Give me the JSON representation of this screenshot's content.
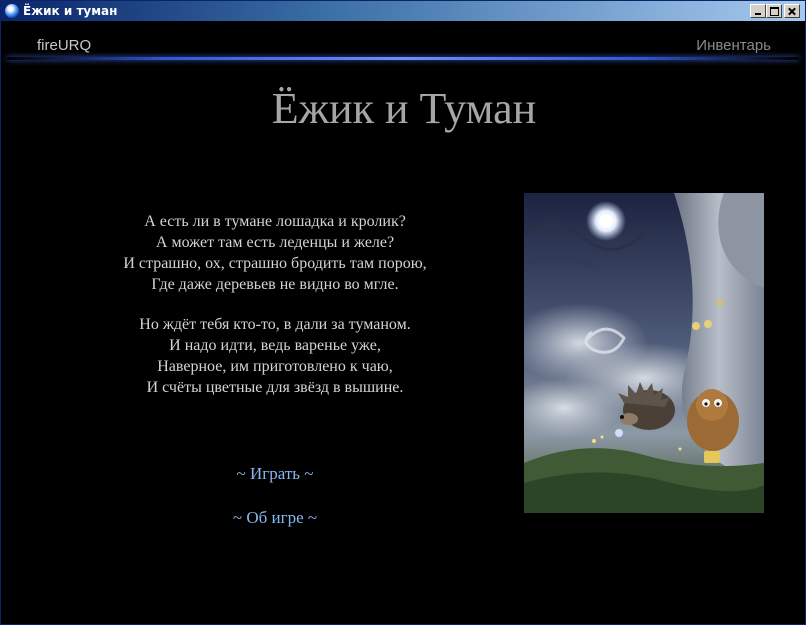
{
  "window": {
    "title": "Ёжик и туман"
  },
  "header": {
    "brand": "fireURQ",
    "inventory_label": "Инвентарь"
  },
  "game": {
    "title": "Ёжик и Туман",
    "poem": [
      "А есть ли в тумане лошадка и кролик?",
      "А может там есть леденцы и желе?",
      "И страшно, ох, страшно бродить там порою,",
      "Где даже деревьев не видно во мгле.",
      "",
      "Но ждёт тебя кто-то, в дали за туманом.",
      "И надо идти, ведь варенье уже,",
      "Наверное, им приготовлено к чаю,",
      "И счёты цветные для звёзд в вышине."
    ],
    "menu": {
      "play": "~ Играть ~",
      "about": "~ Об игре ~"
    }
  },
  "colors": {
    "background": "#000000",
    "title_text": "#a6a6a6",
    "poem_text": "#d4d4d4",
    "link_text": "#87b7f0",
    "accent_line": "#2f57d6"
  }
}
